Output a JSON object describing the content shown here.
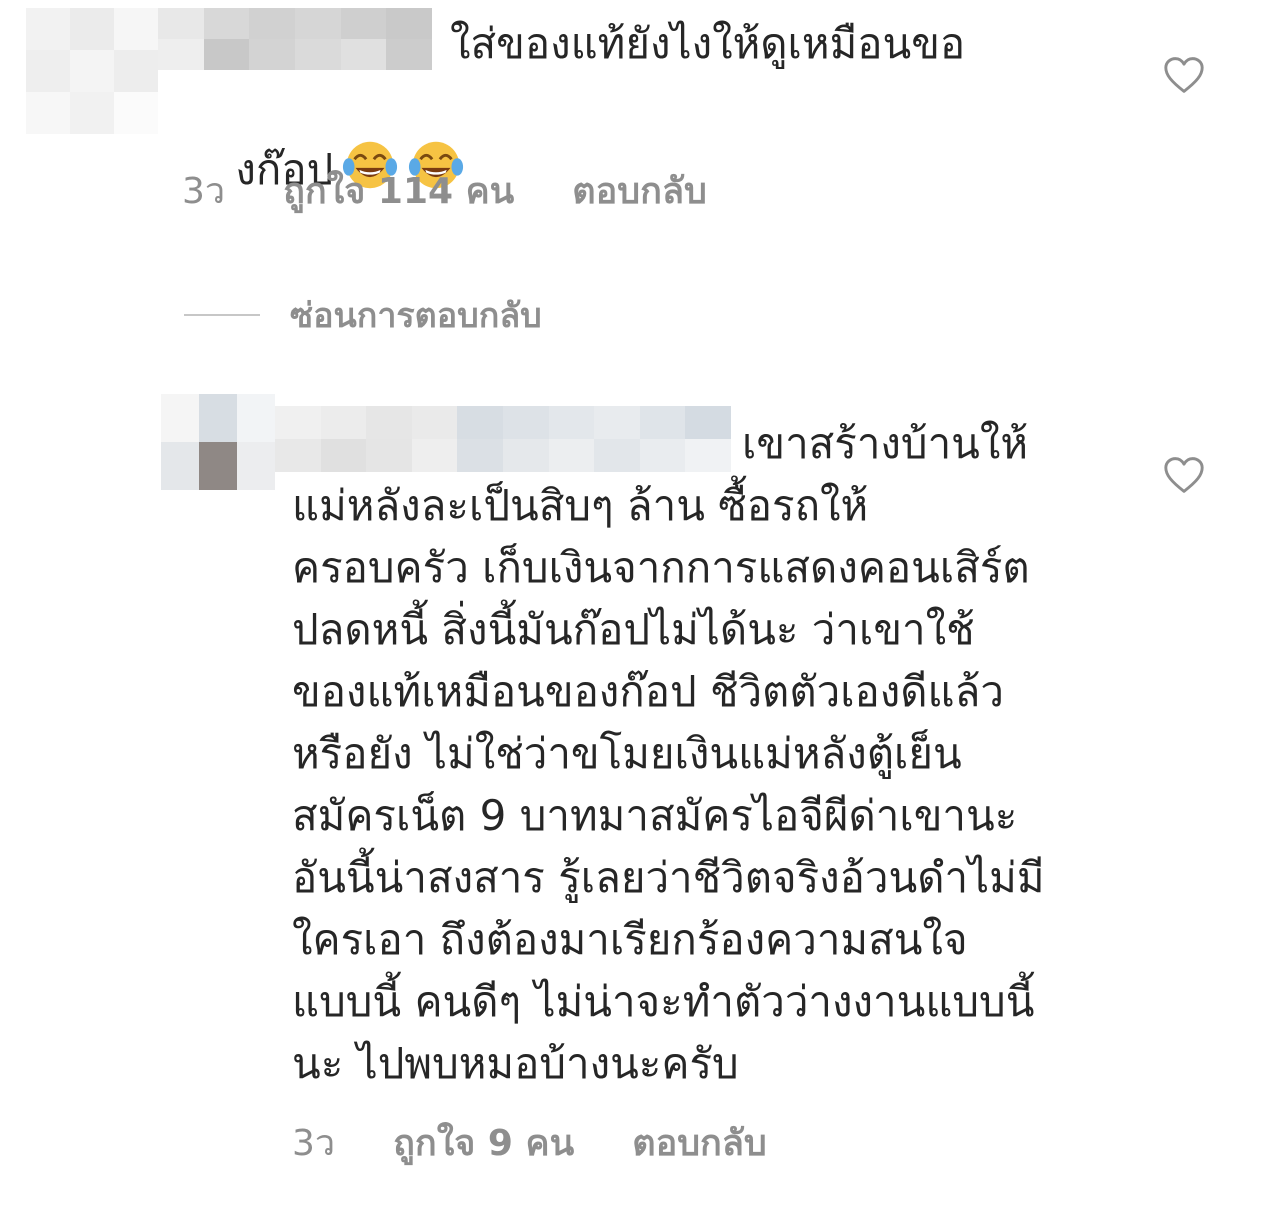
{
  "comments": [
    {
      "text_line1": "ใส่ของแท้ยังไงให้ดูเหมือนขอ",
      "text_line2": "งก๊อป",
      "emojis": [
        "face-with-tears-of-joy",
        "face-with-tears-of-joy"
      ],
      "time": "3ว",
      "likes": "ถูกใจ 114 คน",
      "reply": "ตอบกลับ"
    },
    {
      "first_line": "เขาสร้างบ้านให้",
      "lines": [
        "แม่หลังละเป็นสิบๆ ล้าน ซื้อรถให้",
        "ครอบครัว เก็บเงินจากการแสดงคอนเสิร์ต",
        "ปลดหนี้ สิ่งนี้มันก๊อปไม่ได้นะ ว่าเขาใช้",
        "ของแท้เหมือนของก๊อป ชีวิตตัวเองดีแล้ว",
        "หรือยัง ไม่ใช่ว่าขโมยเงินแม่หลังตู้เย็น",
        "สมัครเน็ต 9 บาทมาสมัครไอจีผีด่าเขานะ",
        "อันนี้น่าสงสาร รู้เลยว่าชีวิตจริงอ้วนดำไม่มี",
        "ใครเอา ถึงต้องมาเรียกร้องความสนใจ",
        "แบบนี้ คนดีๆ ไม่น่าจะทำตัวว่างงานแบบนี้",
        "นะ ไปพบหมอบ้างนะครับ"
      ],
      "time": "3ว",
      "likes": "ถูกใจ 9 คน",
      "reply": "ตอบกลับ"
    }
  ],
  "hide_replies": "ซ่อนการตอบกลับ",
  "icons": {
    "like": "heart-outline-icon"
  },
  "colors": {
    "text": "#262626",
    "meta": "#8e8e8e",
    "divider": "#c7c7c7"
  }
}
